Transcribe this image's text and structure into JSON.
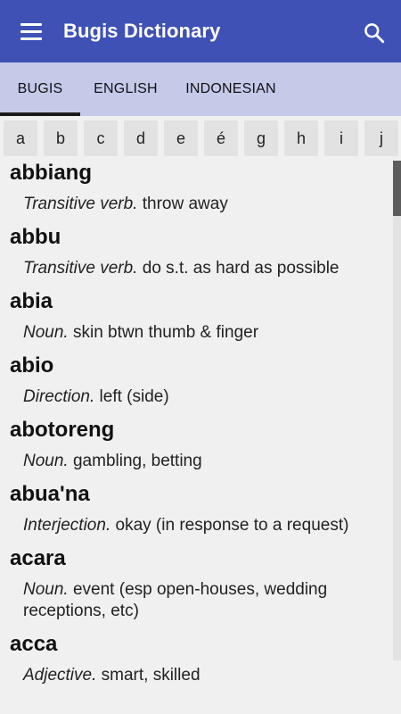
{
  "app": {
    "title": "Bugis Dictionary"
  },
  "icons": {
    "menu": "hamburger-menu-icon",
    "search": "search-icon"
  },
  "colors": {
    "appbar": "#3f51b5",
    "tabbar": "#c5cae9",
    "background": "#f0f0f0"
  },
  "tabs": [
    {
      "label": "BUGIS",
      "selected": true
    },
    {
      "label": "ENGLISH",
      "selected": false
    },
    {
      "label": "INDONESIAN",
      "selected": false
    }
  ],
  "letters": [
    "a",
    "b",
    "c",
    "d",
    "e",
    "é",
    "g",
    "h",
    "i",
    "j"
  ],
  "entries": [
    {
      "word": "abbiang",
      "pos": "Transitive verb.",
      "meaning": "throw away"
    },
    {
      "word": "abbu",
      "pos": "Transitive verb.",
      "meaning": "do s.t. as hard as possible"
    },
    {
      "word": "abia",
      "pos": "Noun.",
      "meaning": "skin btwn thumb & finger"
    },
    {
      "word": "abio",
      "pos": "Direction.",
      "meaning": "left (side)"
    },
    {
      "word": "abotoreng",
      "pos": "Noun.",
      "meaning": "gambling, betting"
    },
    {
      "word": "abua'na",
      "pos": "Interjection.",
      "meaning": "okay (in response to a request)"
    },
    {
      "word": "acara",
      "pos": "Noun.",
      "meaning": "event (esp open-houses, wedding receptions, etc)"
    },
    {
      "word": "acca",
      "pos": "Adjective.",
      "meaning": "smart, skilled"
    }
  ]
}
